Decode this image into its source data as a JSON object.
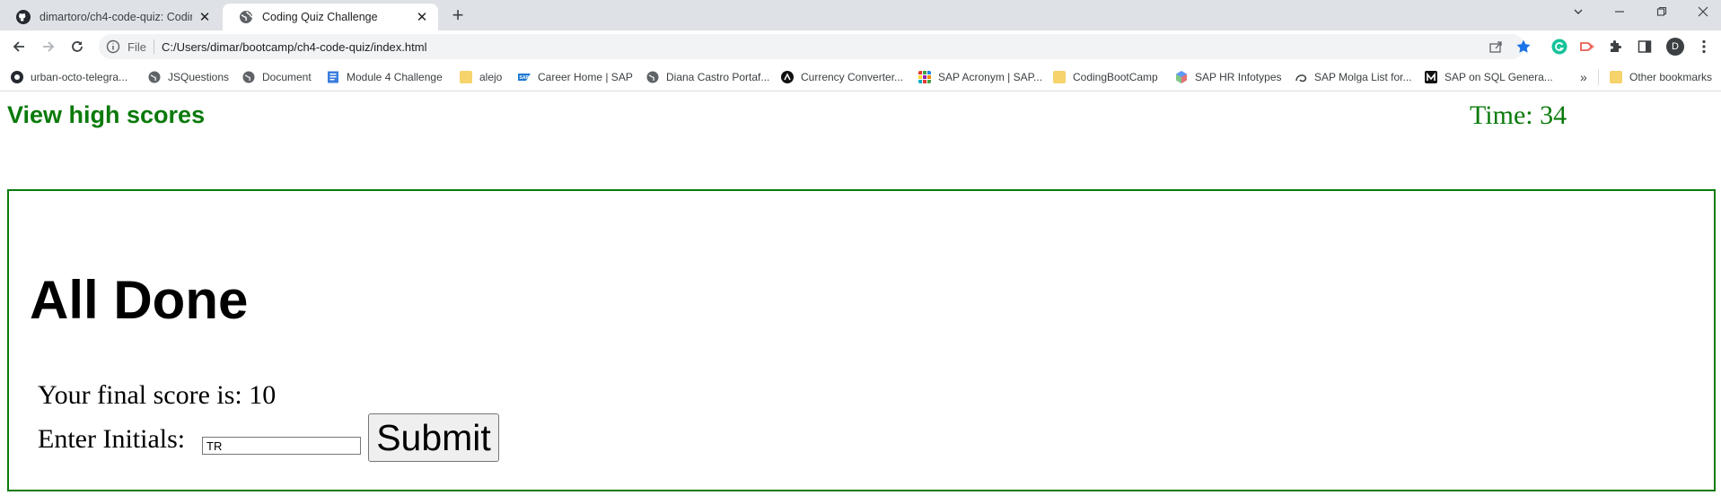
{
  "browser": {
    "tabs": [
      {
        "title": "dimartoro/ch4-code-quiz: Coding",
        "icon": "github-icon",
        "active": false
      },
      {
        "title": "Coding Quiz Challenge",
        "icon": "globe-icon",
        "active": true
      }
    ],
    "new_tab_symbol": "+",
    "address": {
      "scheme_label": "File",
      "url": "C:/Users/dimar/bootcamp/ch4-code-quiz/index.html"
    },
    "profile_initial": "D",
    "bookmarks": [
      {
        "label": "urban-octo-telegra...",
        "icon": "github-icon"
      },
      {
        "label": "JSQuestions",
        "icon": "globe-icon"
      },
      {
        "label": "Document",
        "icon": "globe-icon"
      },
      {
        "label": "Module 4 Challenge",
        "icon": "doc-icon"
      },
      {
        "label": "alejo",
        "icon": "folder-icon"
      },
      {
        "label": "Career Home | SAP",
        "icon": "sap-icon"
      },
      {
        "label": "Diana Castro Portaf...",
        "icon": "globe-icon"
      },
      {
        "label": "Currency Converter...",
        "icon": "converter-icon"
      },
      {
        "label": "SAP Acronym | SAP...",
        "icon": "grid-icon"
      },
      {
        "label": "CodingBootCamp",
        "icon": "folder-icon"
      },
      {
        "label": "SAP HR Infotypes",
        "icon": "cube-icon"
      },
      {
        "label": "SAP Molga List for...",
        "icon": "swirl-icon"
      },
      {
        "label": "SAP on SQL Genera...",
        "icon": "m-icon"
      }
    ],
    "more_bookmarks_symbol": "»",
    "other_bookmarks": "Other bookmarks"
  },
  "page": {
    "view_high_scores": "View high scores",
    "timer": "Time: 34",
    "done_title": "All Done",
    "final_score": "Your final score is: 10",
    "initials_label": "Enter Initials:",
    "initials_value": "TR",
    "submit_label": "Submit"
  },
  "colors": {
    "accent_green": "#0a7a0a",
    "tab_strip": "#dee1e6",
    "omnibox": "#f1f3f4",
    "star_blue": "#1a73e8"
  }
}
